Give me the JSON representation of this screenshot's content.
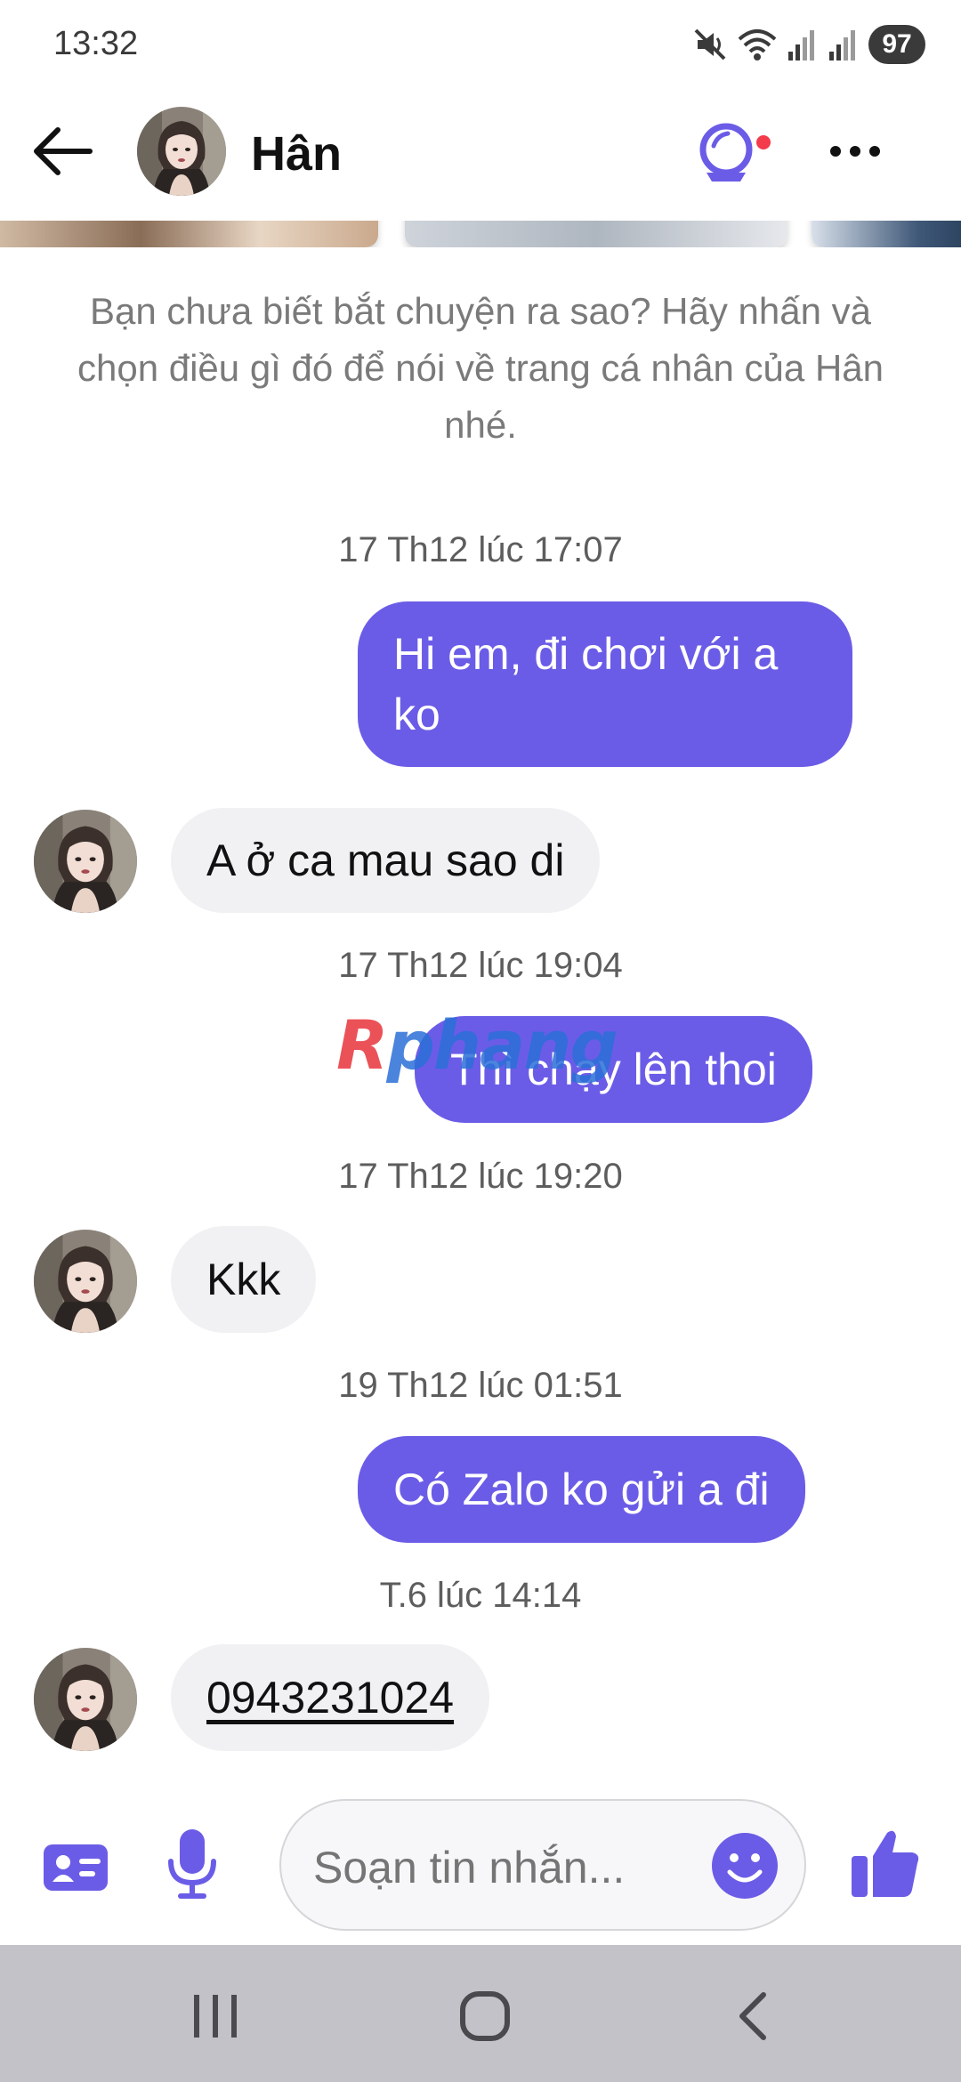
{
  "status_bar": {
    "time": "13:32",
    "battery": "97",
    "icons": [
      "mute-icon",
      "wifi-icon",
      "signal-icon",
      "signal-icon",
      "battery-icon"
    ]
  },
  "header": {
    "contact_name": "Hân",
    "icons": [
      "back-arrow-icon",
      "video-call-icon",
      "more-icon"
    ],
    "accent_color": "#6b5ce7",
    "notification_dot_color": "#f33b4b"
  },
  "intro": {
    "text": "Bạn chưa biết bắt chuyện ra sao? Hãy nhấn và chọn điều gì đó để nói về trang cá nhân của Hân nhé."
  },
  "messages": [
    {
      "type": "timestamp",
      "text": "17 Th12 lúc 17:07"
    },
    {
      "type": "outgoing",
      "text": "Hi em, đi chơi với a ko"
    },
    {
      "type": "incoming",
      "text": "A ở ca mau sao di"
    },
    {
      "type": "timestamp",
      "text": "17 Th12 lúc 19:04"
    },
    {
      "type": "outgoing",
      "text": "Thì chạy lên thoi"
    },
    {
      "type": "timestamp",
      "text": "17 Th12 lúc 19:20"
    },
    {
      "type": "incoming",
      "text": "Kkk"
    },
    {
      "type": "timestamp",
      "text": "19 Th12 lúc 01:51"
    },
    {
      "type": "outgoing",
      "text": "Có Zalo ko gửi a đi"
    },
    {
      "type": "timestamp",
      "text": "T.6 lúc 14:14"
    },
    {
      "type": "incoming",
      "text": "0943231024",
      "is_link": true
    }
  ],
  "watermark": {
    "r": "R",
    "rest": "phang"
  },
  "composer": {
    "placeholder": "Soạn tin nhắn...",
    "icons": [
      "contact-card-icon",
      "microphone-icon",
      "emoji-icon",
      "thumbs-up-icon"
    ]
  },
  "nav_bar": {
    "icons": [
      "recents-icon",
      "home-icon",
      "back-icon"
    ]
  },
  "colors": {
    "outgoing_bubble": "#6b5ce7",
    "incoming_bubble": "#f1f1f4",
    "nav_bar": "#c2c2c8"
  }
}
